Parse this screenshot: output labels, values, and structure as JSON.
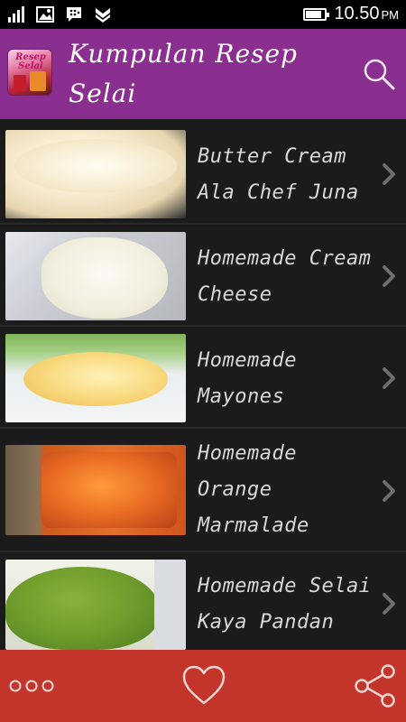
{
  "status_bar": {
    "time": "10.50",
    "ampm": "PM",
    "battery_level": 0.85,
    "icons": [
      "signal-icon",
      "image-icon",
      "bbm-icon",
      "notification-icon"
    ]
  },
  "app_bar": {
    "title": "Kumpulan Resep Selai",
    "logo_text": "Resep Selai",
    "background": "#8a2f8f",
    "search_icon": "search-icon"
  },
  "recipes": [
    {
      "title": "Butter Cream Ala Chef Juna",
      "thumb": "butter-cream-photo"
    },
    {
      "title": "Homemade Cream Cheese",
      "thumb": "cream-cheese-photo"
    },
    {
      "title": "Homemade Mayones",
      "thumb": "mayones-photo"
    },
    {
      "title": "Homemade Orange Marmalade",
      "thumb": "orange-marmalade-photo"
    },
    {
      "title": "Homemade Selai Kaya Pandan",
      "thumb": "kaya-pandan-photo"
    }
  ],
  "bottom_bar": {
    "background": "#c3352b",
    "icons": [
      "more-icon",
      "heart-icon",
      "share-icon"
    ]
  }
}
